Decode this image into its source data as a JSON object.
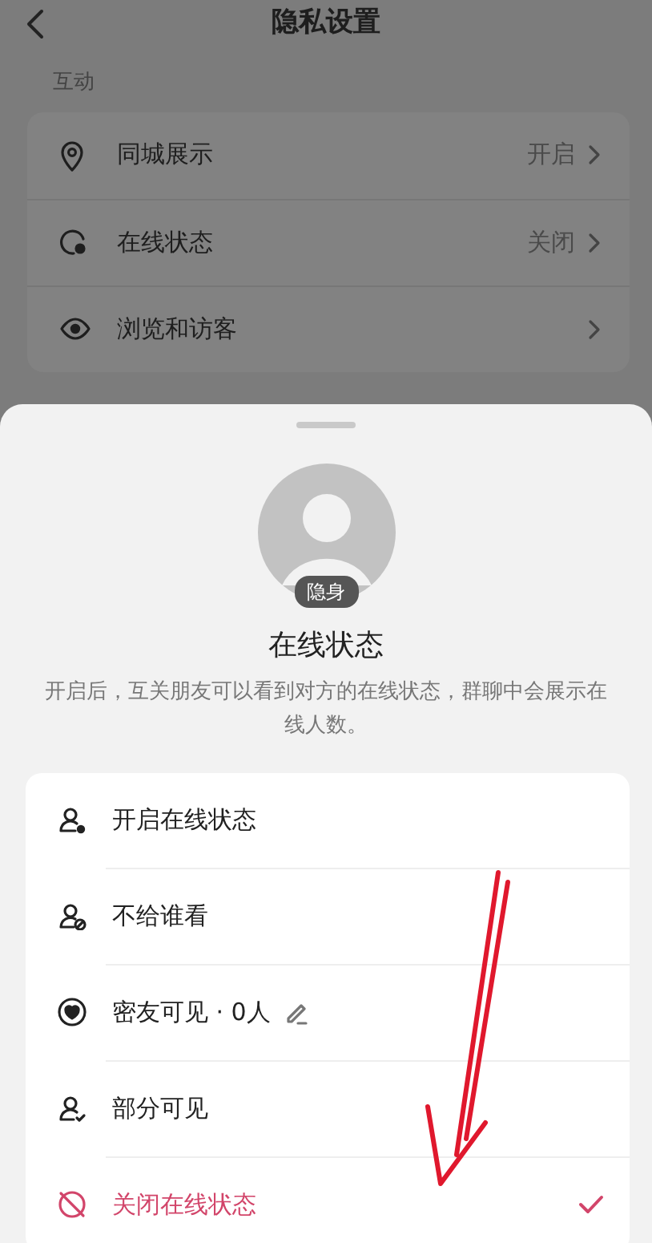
{
  "header": {
    "title": "隐私设置"
  },
  "section": {
    "label": "互动",
    "rows": [
      {
        "kind": "location",
        "label": "同城展示",
        "value": "开启"
      },
      {
        "kind": "online",
        "label": "在线状态",
        "value": "关闭"
      },
      {
        "kind": "eye",
        "label": "浏览和访客"
      }
    ]
  },
  "sheet": {
    "badge": "隐身",
    "title": "在线状态",
    "description": "开启后，互关朋友可以看到对方的在线状态，群聊中会展示在线人数。",
    "options": [
      {
        "kind": "on",
        "label": "开启在线状态",
        "selected": false
      },
      {
        "kind": "hide",
        "label": "不给谁看",
        "selected": false
      },
      {
        "kind": "friends",
        "label": "密友可见 · 0人",
        "selected": false
      },
      {
        "kind": "partial",
        "label": "部分可见",
        "selected": false
      },
      {
        "kind": "off",
        "label": "关闭在线状态",
        "selected": true
      }
    ]
  }
}
